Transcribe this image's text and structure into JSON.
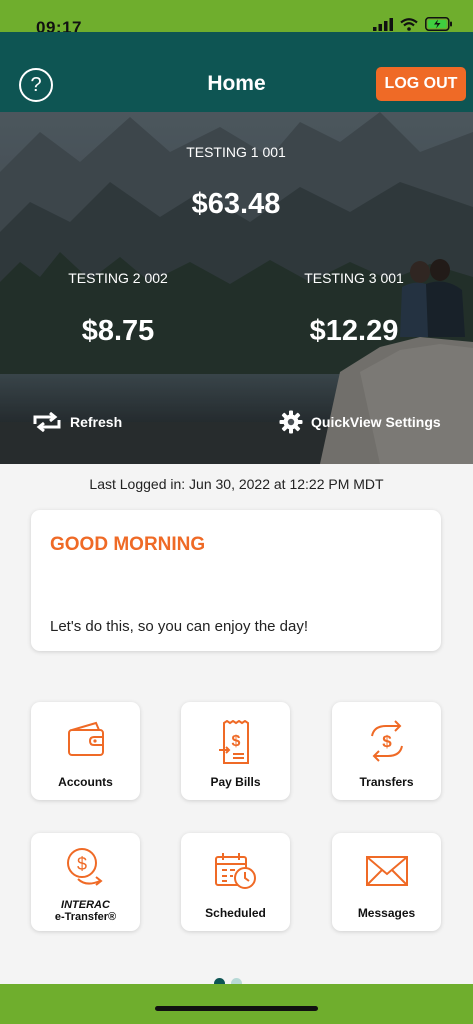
{
  "status_bar": {
    "time": "09:17"
  },
  "header": {
    "title": "Home",
    "help_symbol": "?",
    "logout_label": "LOG OUT"
  },
  "accounts": [
    {
      "name": "TESTING 1 001",
      "balance": "$63.48"
    },
    {
      "name": "TESTING 2 002",
      "balance": "$8.75"
    },
    {
      "name": "TESTING 3 001",
      "balance": "$12.29"
    }
  ],
  "hero_actions": {
    "refresh_label": "Refresh",
    "quickview_label": "QuickView Settings"
  },
  "last_login": "Last Logged in: Jun 30, 2022 at 12:22 PM  MDT",
  "greeting": {
    "title": "GOOD MORNING",
    "message": "Let's do this, so you can enjoy the day!"
  },
  "tiles": [
    {
      "label": "Accounts",
      "icon": "wallet-icon"
    },
    {
      "label": "Pay Bills",
      "icon": "bill-icon"
    },
    {
      "label": "Transfers",
      "icon": "transfer-icon"
    },
    {
      "label_line1": "INTERAC",
      "label_line2": "e-Transfer®",
      "icon": "etransfer-icon"
    },
    {
      "label": "Scheduled",
      "icon": "calendar-clock-icon"
    },
    {
      "label": "Messages",
      "icon": "envelope-icon"
    }
  ],
  "colors": {
    "brand_green": "#6fae2d",
    "header_teal": "#0e5553",
    "accent_orange": "#ef6a26"
  }
}
